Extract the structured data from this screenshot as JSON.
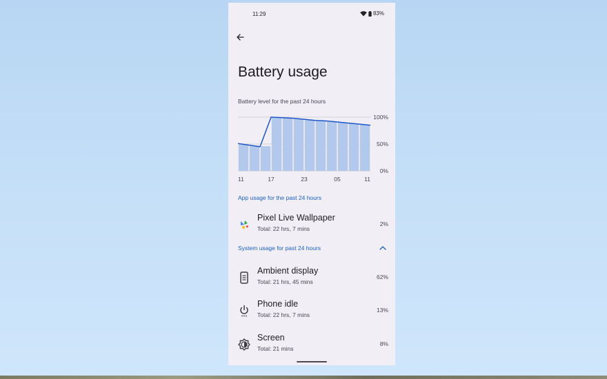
{
  "status_bar": {
    "time": "11:29",
    "battery_percent": "83%"
  },
  "page": {
    "title": "Battery usage"
  },
  "chart_caption": "Battery level for the past 24 hours",
  "chart_data": {
    "type": "area",
    "title": "Battery level for the past 24 hours",
    "x_tick_labels": [
      "11",
      "17",
      "23",
      "05",
      "11"
    ],
    "y_tick_labels": [
      "100%",
      "50%",
      "0%"
    ],
    "ylim": [
      0,
      100
    ],
    "grid": true,
    "series": [
      {
        "values": [
          51,
          48,
          45,
          100,
          99,
          98,
          96,
          94,
          93,
          91,
          89,
          87,
          85
        ]
      }
    ],
    "bars": [
      49,
      46,
      46,
      99,
      98,
      97,
      95,
      93,
      92,
      90,
      88,
      86
    ]
  },
  "app_section": {
    "header": "App usage for the past 24 hours",
    "items": [
      {
        "icon": "pixel-live-wallpaper-icon",
        "title": "Pixel Live Wallpaper",
        "subtitle": "Total: 22 hrs, 7 mins",
        "percent": "2%"
      }
    ]
  },
  "system_section": {
    "header": "System usage for past 24 hours",
    "items": [
      {
        "icon": "ambient-display-icon",
        "title": "Ambient display",
        "subtitle": "Total: 21 hrs, 45 mins",
        "percent": "62%"
      },
      {
        "icon": "power-icon",
        "title": "Phone idle",
        "subtitle": "Total: 22 hrs, 7 mins",
        "percent": "13%"
      },
      {
        "icon": "brightness-icon",
        "title": "Screen",
        "subtitle": "Total: 21 mins",
        "percent": "8%"
      }
    ]
  },
  "colors": {
    "accent": "#1a5fc4",
    "bar_fill": "#b3c9ec",
    "line": "#1d55c9",
    "background": "#f1eff5"
  }
}
